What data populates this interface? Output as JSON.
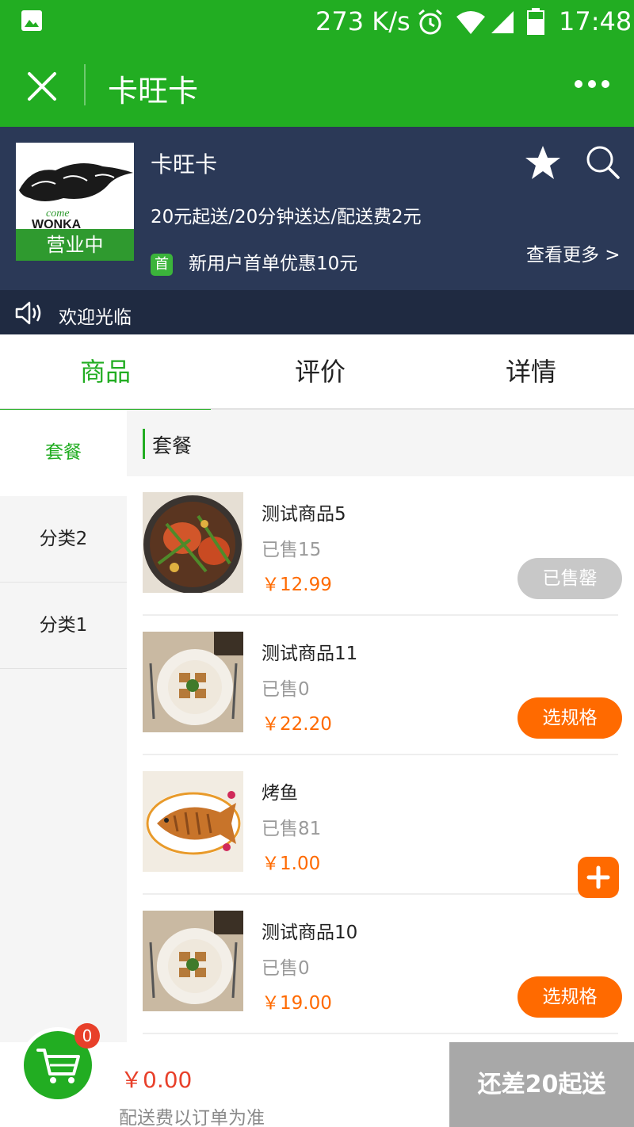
{
  "status_bar": {
    "speed": "273 K/s",
    "time": "17:48",
    "icons": [
      "image-icon",
      "alarm-icon",
      "wifi-icon",
      "signal-icon",
      "battery-icon"
    ]
  },
  "nav": {
    "title": "卡旺卡",
    "icons": [
      "close-icon",
      "more-icon"
    ]
  },
  "store": {
    "name": "卡旺卡",
    "status": "营业中",
    "delivery_info": "20元起送/20分钟送达/配送费2元",
    "first_badge": "首",
    "promo": "新用户首单优惠10元",
    "more_link": "查看更多 >",
    "logo_text": [
      "come",
      "WONKA"
    ]
  },
  "notice": {
    "text": "欢迎光临"
  },
  "tabs": [
    {
      "label": "商品",
      "active": true
    },
    {
      "label": "评价",
      "active": false
    },
    {
      "label": "详情",
      "active": false
    }
  ],
  "categories": [
    {
      "label": "套餐",
      "active": true
    },
    {
      "label": "分类2",
      "active": false
    },
    {
      "label": "分类1",
      "active": false
    }
  ],
  "section": {
    "title": "套餐"
  },
  "products": [
    {
      "name": "测试商品5",
      "sold": "已售15",
      "price": "￥12.99",
      "action": "已售罄",
      "action_type": "soldout"
    },
    {
      "name": "测试商品11",
      "sold": "已售0",
      "price": "￥22.20",
      "action": "选规格",
      "action_type": "spec"
    },
    {
      "name": "烤鱼",
      "sold": "已售81",
      "price": "￥1.00",
      "action": "",
      "action_type": "add"
    },
    {
      "name": "测试商品10",
      "sold": "已售0",
      "price": "￥19.00",
      "action": "选规格",
      "action_type": "spec"
    }
  ],
  "cart": {
    "count": "0",
    "total": "￥0.00",
    "note": "配送费以订单为准",
    "checkout": "还差20起送"
  },
  "colors": {
    "brand_green": "#22ad22",
    "header_navy": "#2b3957",
    "accent_orange": "#ff6a00",
    "price_red": "#e8402a"
  }
}
